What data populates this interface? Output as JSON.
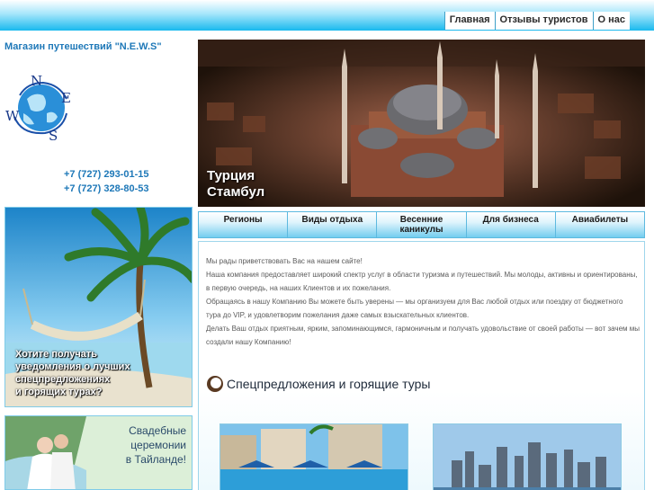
{
  "nav": {
    "items": [
      {
        "label": "Главная"
      },
      {
        "label": "Отзывы туристов"
      },
      {
        "label": "О нас"
      }
    ]
  },
  "sidebar": {
    "shop_title": "Магазин путешествий \"N.E.W.S\"",
    "logo_letters": {
      "n": "N",
      "e": "E",
      "w": "W",
      "s": "S"
    },
    "phones": [
      "+7 (727) 293-01-15",
      "+7 (727) 328-80-53"
    ],
    "banner1_lines": [
      "Хотите получать",
      "уведомления о лучших",
      "спецпредложениях",
      "и горящих турах?"
    ],
    "banner2_lines": [
      "Свадебные",
      "церемонии",
      "в Тайланде!"
    ]
  },
  "hero": {
    "caption_lines": [
      "Турция",
      "Стамбул"
    ]
  },
  "tabs": [
    {
      "label": "Регионы"
    },
    {
      "label": "Виды отдыха"
    },
    {
      "label": "Весенние каникулы"
    },
    {
      "label": "Для бизнеса"
    },
    {
      "label": "Авиабилеты"
    }
  ],
  "main": {
    "intro": [
      "Мы рады приветствовать Вас на нашем сайте!",
      "Наша компания предоставляет широкий спектр услуг в области туризма и путешествий. Мы молоды, активны и ориентированы, в первую очередь, на наших Клиентов и их пожелания.",
      "Обращаясь в нашу Компанию Вы можете быть уверены — мы организуем для Вас любой отдых или поездку от бюджетного тура до VIP, и удовлетворим пожелания даже самых взыскательных клиентов.",
      "Делать Ваш отдых приятным, ярким, запоминающимся, гармоничным и получать удовольствие от своей работы — вот зачем мы создали нашу Компанию!"
    ],
    "section_title": "Спецпредложения и горящие туры"
  },
  "colors": {
    "accent": "#1e78b8",
    "top_bar": "#19b9ee",
    "tab_border": "#5db9df"
  },
  "icons": {
    "section_icon": "coconut-icon",
    "logo": "globe-compass-logo"
  }
}
